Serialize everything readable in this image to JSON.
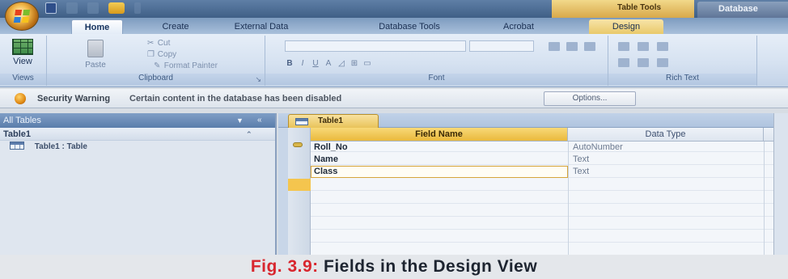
{
  "app": {
    "context_tab_title": "Table Tools",
    "title": "Database"
  },
  "quick_access": {
    "icons": [
      "save-icon",
      "undo-icon",
      "redo-icon",
      "open-folder-icon",
      "customize-icon"
    ]
  },
  "ribbon": {
    "tabs": [
      {
        "label": "Home",
        "active": true
      },
      {
        "label": "Create"
      },
      {
        "label": "External Data"
      },
      {
        "label": "Database Tools"
      },
      {
        "label": "Acrobat"
      },
      {
        "label": "Design",
        "contextual": true
      }
    ],
    "groups": {
      "views": {
        "label": "Views",
        "view_button": "View"
      },
      "clipboard": {
        "label": "Clipboard",
        "paste": "Paste",
        "cut": "Cut",
        "copy": "Copy",
        "format_painter": "Format Painter"
      },
      "font": {
        "label": "Font"
      },
      "rich_text": {
        "label": "Rich Text"
      }
    }
  },
  "security_bar": {
    "title": "Security Warning",
    "message": "Certain content in the database has been disabled",
    "options_button": "Options..."
  },
  "nav_pane": {
    "header": "All Tables",
    "group": "Table1",
    "items": [
      {
        "label": "Table1 : Table"
      }
    ]
  },
  "document": {
    "tab": "Table1",
    "columns": {
      "field_name": "Field Name",
      "data_type": "Data Type"
    },
    "rows": [
      {
        "field": "Roll_No",
        "type": "AutoNumber",
        "primary_key": true
      },
      {
        "field": "Name",
        "type": "Text"
      },
      {
        "field": "Class",
        "type": "Text",
        "selected": true
      }
    ]
  },
  "caption": {
    "fig": "Fig. 3.9:",
    "text": "Fields in the Design View"
  },
  "colors": {
    "accent_gold": "#eab93c",
    "caption_red": "#d8262e",
    "ribbon_blue": "#d6e2f1"
  }
}
